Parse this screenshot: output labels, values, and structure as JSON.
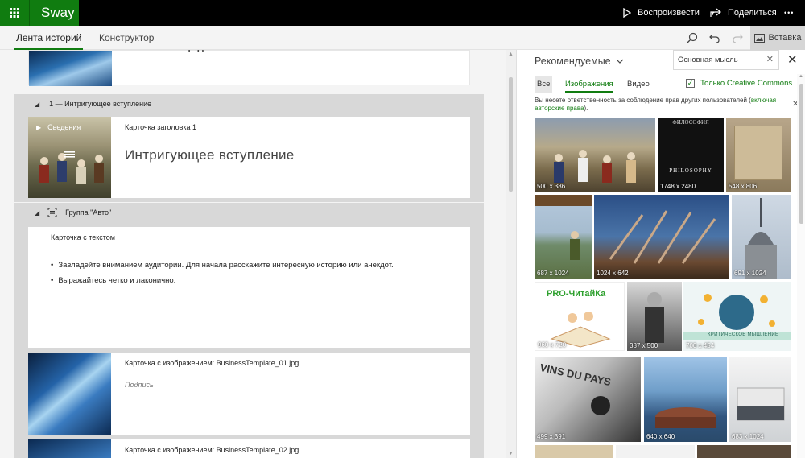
{
  "app": {
    "name": "Sway"
  },
  "topbar": {
    "play_label": "Воспроизвести",
    "share_label": "Поделиться",
    "more_label": "•••"
  },
  "tabs": [
    {
      "label": "Лента историй",
      "active": true
    },
    {
      "label": "Конструктор",
      "active": false
    }
  ],
  "toolbar": {
    "insert_label": "Вставка"
  },
  "storyline": {
    "top_card": {
      "partial_title": "т       п"
    },
    "section1": {
      "title": "1 — Интригующее вступление"
    },
    "title_card": {
      "tag": "Сведения",
      "label": "Карточка заголовка 1",
      "title": "Интригующее вступление"
    },
    "group": {
      "title": "Группа \"Авто\""
    },
    "text_card": {
      "label": "Карточка с текстом",
      "bullets": [
        "Завладейте вниманием аудитории.  Для начала расскажите интересную историю или анекдот.",
        "Выражайтесь четко и лаконично."
      ]
    },
    "image_card1": {
      "label": "Карточка с изображением: BusinessTemplate_01.jpg",
      "caption": "Подпись"
    },
    "image_card2": {
      "label": "Карточка с изображением: BusinessTemplate_02.jpg"
    }
  },
  "panel": {
    "heading": "Рекомендуемые",
    "search_value": "Основная мысль",
    "filters": {
      "all": "Все",
      "images": "Изображения",
      "video": "Видео"
    },
    "cc_label": "Только Creative Commons",
    "cc_checked": true,
    "notice_text": "Вы несете ответственность за соблюдение прав других пользователей (",
    "notice_link": "включая авторские права",
    "notice_end": ").",
    "images": [
      {
        "dim": "500 x 386",
        "scene": "painting"
      },
      {
        "dim": "1748 x 2480",
        "scene": "book-dark",
        "word": "PHILOSOPHY",
        "top_word": "ФИЛОСОФИЯ"
      },
      {
        "dim": "548 x 806",
        "scene": "old-book"
      },
      {
        "dim": "687 x 1024",
        "scene": "person-river"
      },
      {
        "dim": "1024 x 642",
        "scene": "sculpture"
      },
      {
        "dim": "691 x 1024",
        "scene": "spire"
      },
      {
        "dim": "960 x 720",
        "scene": "pro-book",
        "word": "PRO-ЧитайКа"
      },
      {
        "dim": "387 x 500",
        "scene": "etching"
      },
      {
        "dim": "700 x 454",
        "scene": "brain",
        "word": "КРИТИЧЕСКОЕ МЫШЛЕНИЕ"
      },
      {
        "dim": "499 x 391",
        "scene": "bw-person",
        "word": "VINS DU PAYS"
      },
      {
        "dim": "640 x 640",
        "scene": "fort"
      },
      {
        "dim": "683 x 1024",
        "scene": "building"
      }
    ]
  }
}
